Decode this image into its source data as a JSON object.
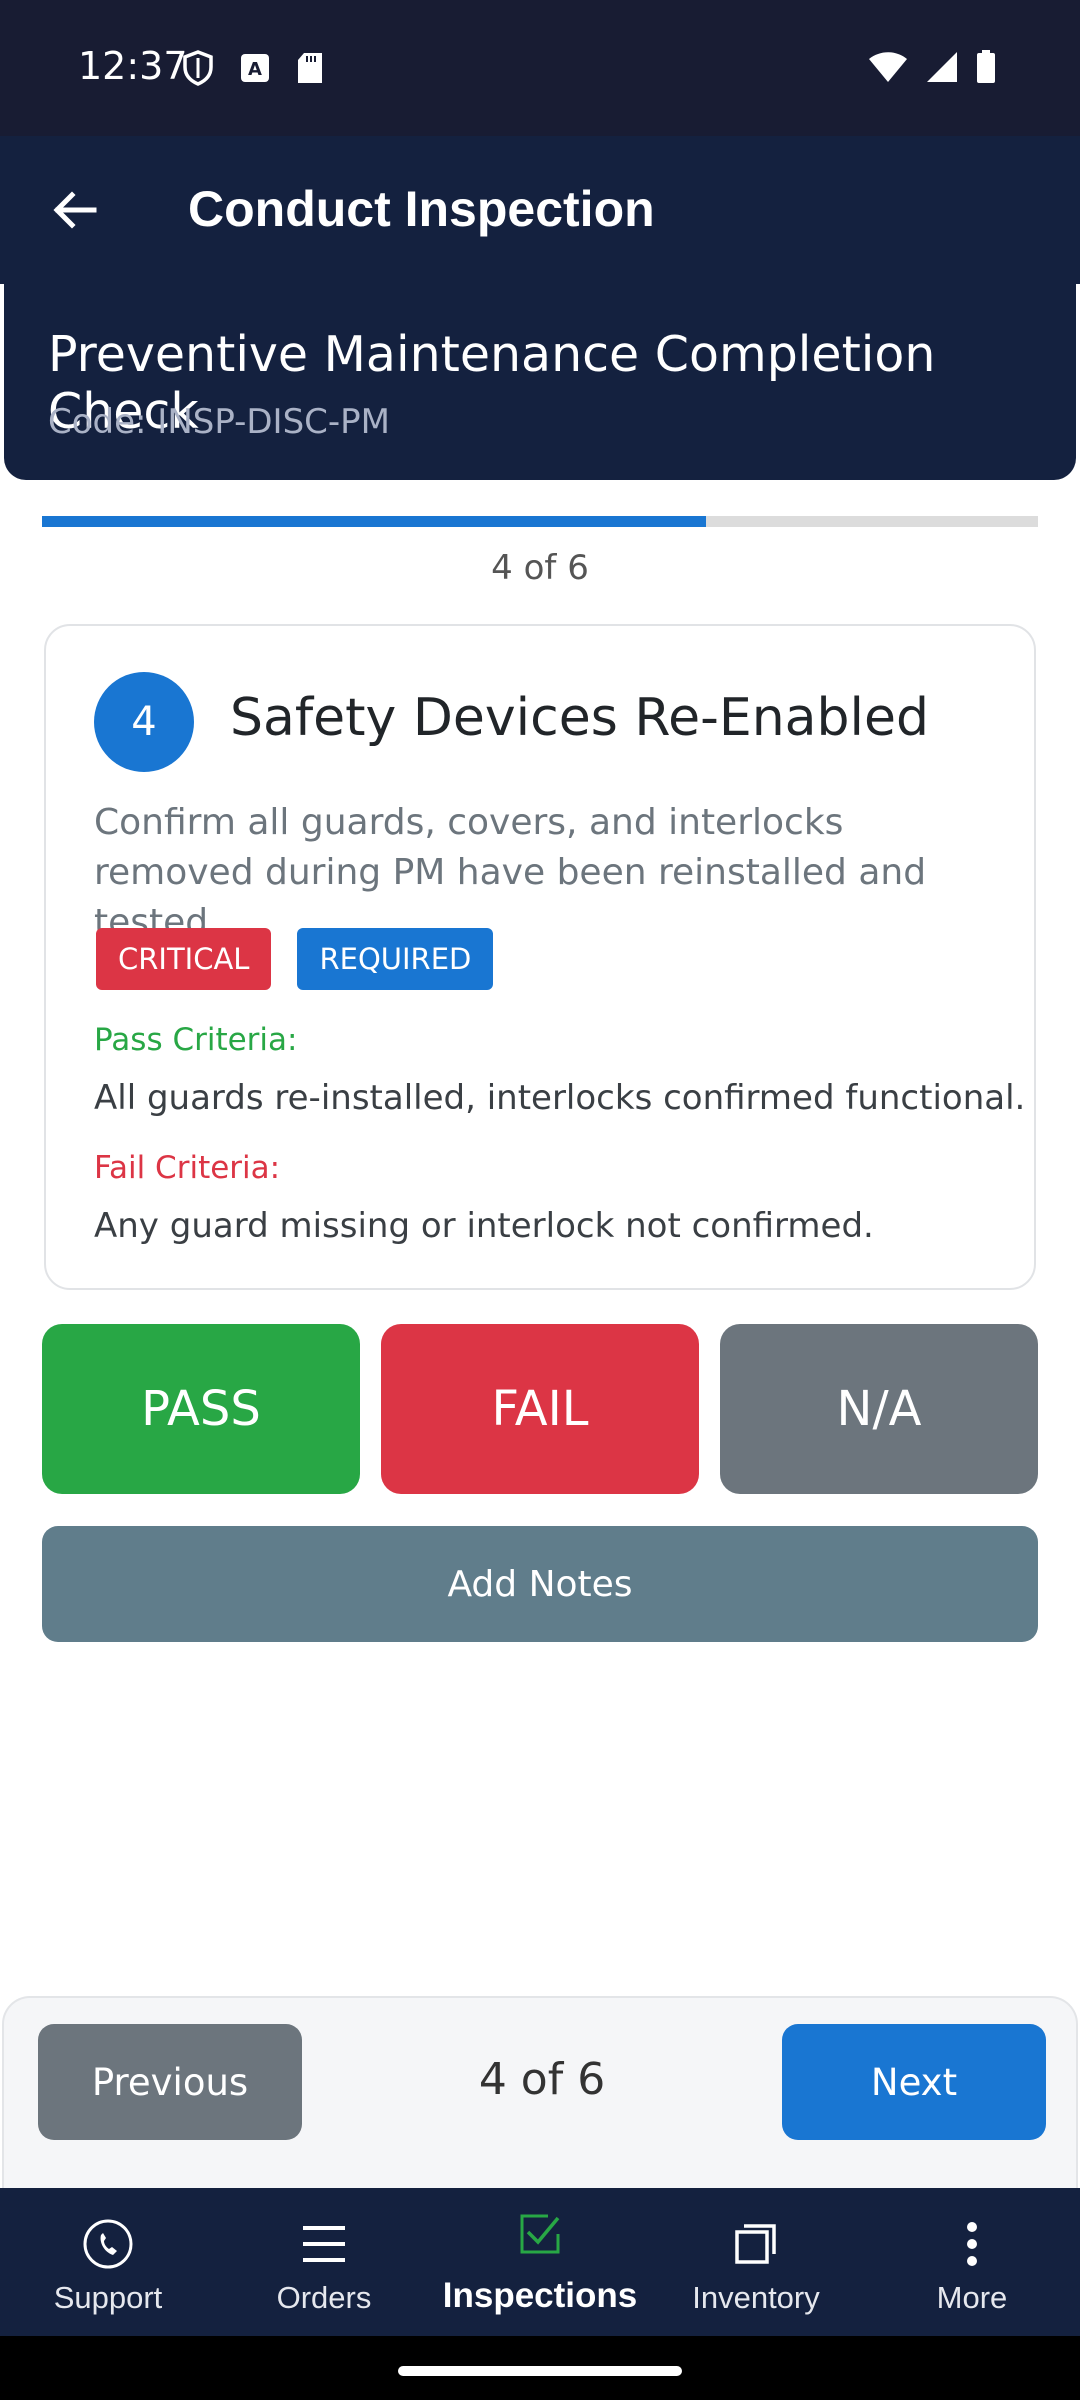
{
  "status_bar": {
    "time": "12:37"
  },
  "app_bar": {
    "title": "Conduct Inspection"
  },
  "checklist": {
    "title": "Preventive Maintenance Completion Check",
    "code": "Code: INSP-DISC-PM"
  },
  "progress": {
    "current": 4,
    "total": 6,
    "label": "4 of 6",
    "fraction": 0.667,
    "color": "#1976d2"
  },
  "item": {
    "number": "4",
    "title": "Safety Devices Re-Enabled",
    "description": "Confirm all guards, covers, and interlocks removed during PM have been reinstalled and tested.",
    "badges": [
      "CRITICAL",
      "REQUIRED"
    ],
    "pass_label": "Pass Criteria:",
    "pass_text": "All guards re-installed, interlocks confirmed functional.",
    "fail_label": "Fail Criteria:",
    "fail_text": "Any guard missing or interlock not confirmed."
  },
  "actions": {
    "pass": "PASS",
    "fail": "FAIL",
    "na": "N/A",
    "notes": "Add Notes"
  },
  "navigation": {
    "previous": "Previous",
    "counter": "4 of 6",
    "next": "Next"
  },
  "tabs": [
    {
      "label": "Support",
      "icon": "phone-icon",
      "active": false
    },
    {
      "label": "Orders",
      "icon": "list-icon",
      "active": false
    },
    {
      "label": "Inspections",
      "icon": "checkbox-icon",
      "active": true
    },
    {
      "label": "Inventory",
      "icon": "box-icon",
      "active": false
    },
    {
      "label": "More",
      "icon": "more-vertical-icon",
      "active": false
    }
  ],
  "colors": {
    "primary_dark": "#14213f",
    "accent_blue": "#1976d2",
    "pass_green": "#28a745",
    "fail_red": "#dc3545",
    "neutral_gray": "#6c757d",
    "notes_slate": "#607d8b"
  }
}
